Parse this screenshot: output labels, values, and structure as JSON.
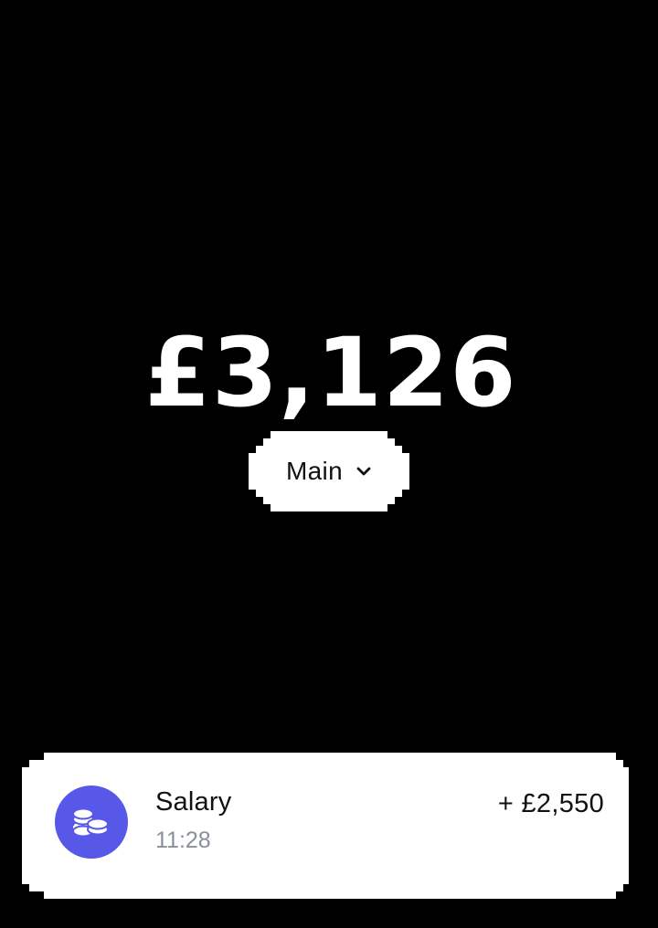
{
  "balance": {
    "amount": "£3,126"
  },
  "account_selector": {
    "label": "Main",
    "icon": "chevron-down-icon"
  },
  "transactions": [
    {
      "title": "Salary",
      "time": "11:28",
      "amount": "+ £2,550",
      "icon": "coins-icon",
      "icon_color": "#5757e8"
    }
  ],
  "colors": {
    "background": "#000000",
    "surface": "#ffffff",
    "text_primary": "#111111",
    "text_secondary": "#8a8f98",
    "accent": "#5757e8"
  }
}
